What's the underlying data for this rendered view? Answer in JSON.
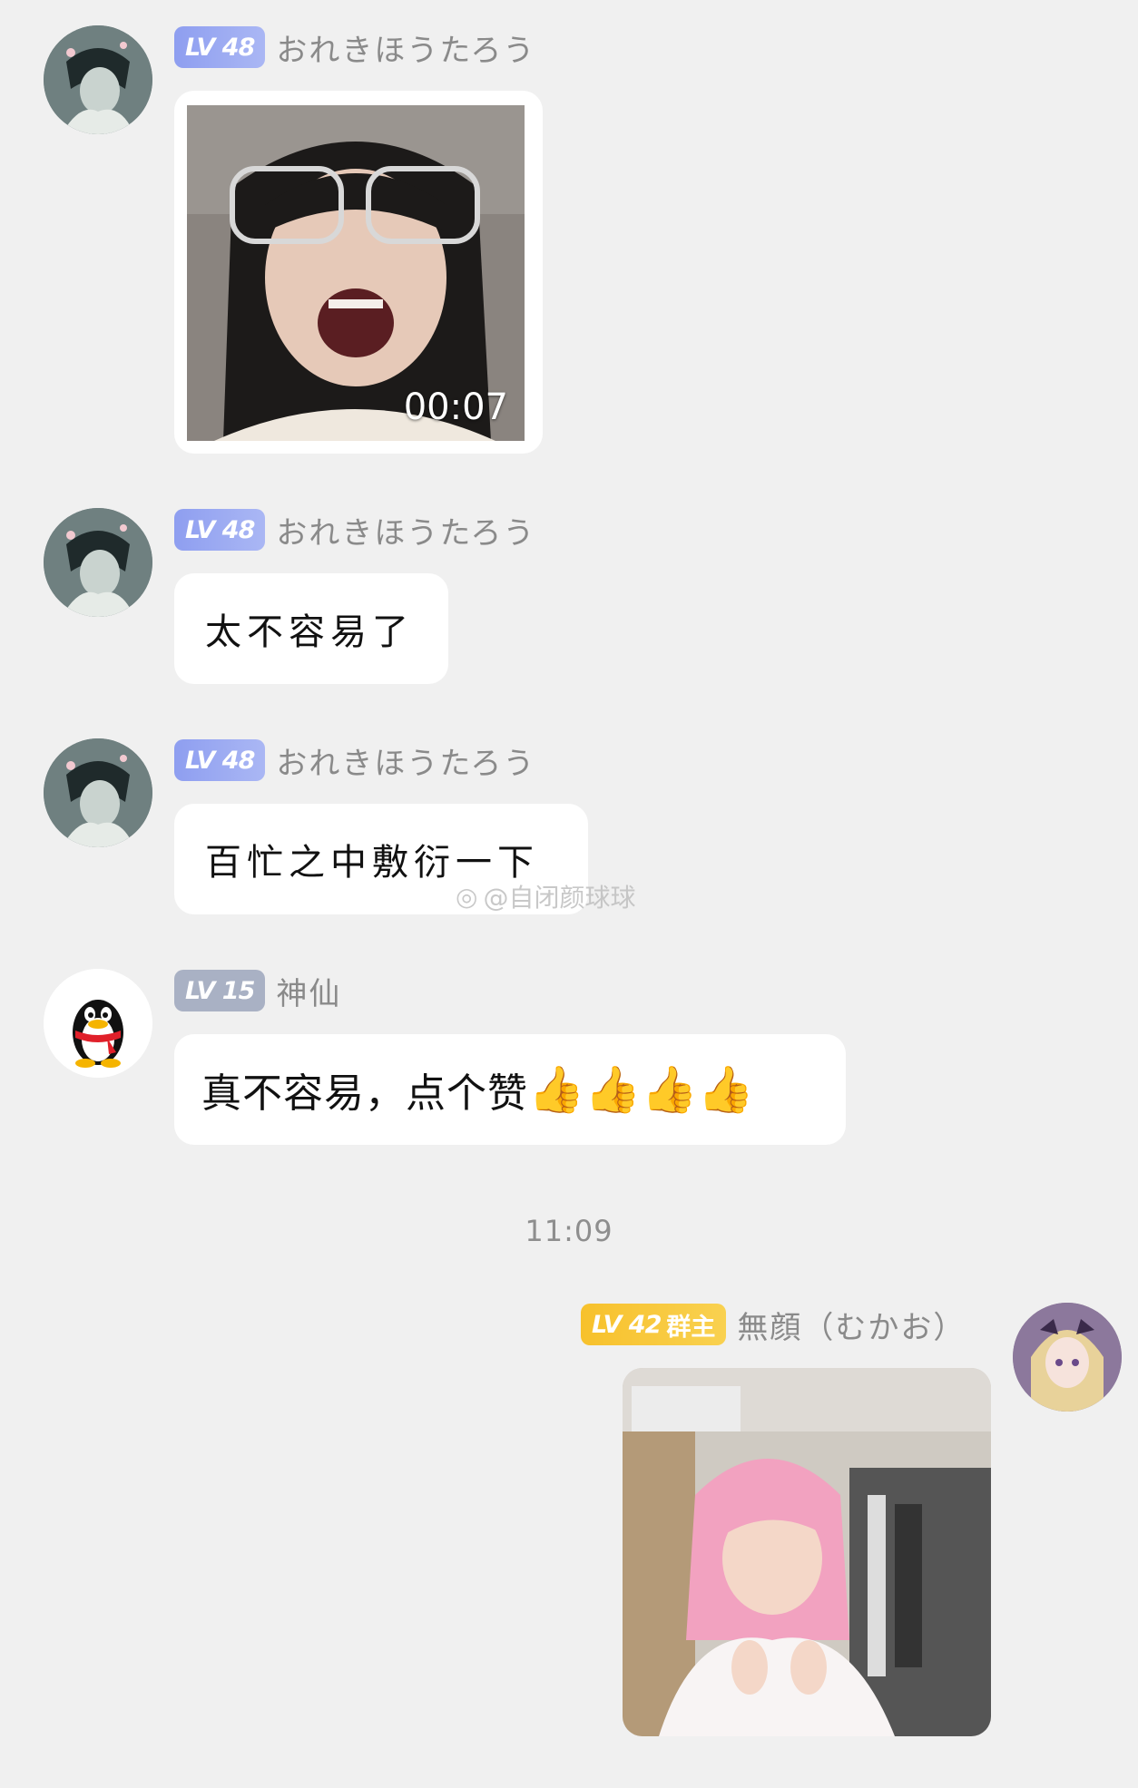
{
  "messages": [
    {
      "user": {
        "level": "LV 48",
        "name": "おれきほうたろう"
      },
      "type": "video",
      "duration": "00:07"
    },
    {
      "user": {
        "level": "LV 48",
        "name": "おれきほうたろう"
      },
      "type": "text",
      "text": "太不容易了"
    },
    {
      "user": {
        "level": "LV 48",
        "name": "おれきほうたろう"
      },
      "type": "text",
      "text": "百忙之中敷衍一下"
    },
    {
      "user": {
        "level": "LV 15",
        "name": "神仙"
      },
      "type": "text",
      "text": "真不容易，点个赞",
      "emoji": [
        "👍",
        "👍",
        "👍",
        "👍"
      ]
    },
    {
      "user": {
        "level": "LV 42",
        "role": "群主",
        "name": "無顔（むかお）"
      },
      "type": "image"
    }
  ],
  "timestamp": "11:09",
  "watermark": "@自闭颜球球",
  "colors": {
    "background": "#f0f0f0",
    "level_blue": "#8e9ef0",
    "level_gray": "#a9b1c4",
    "level_gold": "#f7c12c"
  }
}
